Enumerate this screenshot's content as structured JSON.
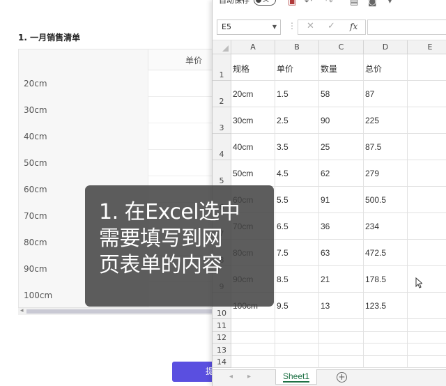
{
  "web_form": {
    "title": "1. 一月销售清单",
    "header_price": "单价",
    "rows": [
      "20cm",
      "30cm",
      "40cm",
      "50cm",
      "60cm",
      "70cm",
      "80cm",
      "90cm",
      "100cm"
    ],
    "submit_label": "提交",
    "accent_color": "#5a4fe0"
  },
  "excel": {
    "toolbar": {
      "autosave_label": "自动保存",
      "autosave_state": "关",
      "icons": [
        "save-icon",
        "undo-icon",
        "redo-icon",
        "print-preview-icon",
        "camera-icon",
        "more-icon"
      ]
    },
    "formula_bar": {
      "name_box": "E5",
      "separator": "⋮",
      "cancel": "✕",
      "enter": "✓",
      "fx": "fx",
      "formula": ""
    },
    "columns": [
      "A",
      "B",
      "C",
      "D",
      "E"
    ],
    "row_numbers": [
      "1",
      "2",
      "3",
      "4",
      "5",
      "6",
      "7",
      "8",
      "9",
      "10",
      "11",
      "12",
      "13",
      "14"
    ],
    "table": [
      [
        "规格",
        "单价",
        "数量",
        "总价"
      ],
      [
        "20cm",
        "1.5",
        "58",
        "87"
      ],
      [
        "30cm",
        "2.5",
        "90",
        "225"
      ],
      [
        "40cm",
        "3.5",
        "25",
        "87.5"
      ],
      [
        "50cm",
        "4.5",
        "62",
        "279"
      ],
      [
        "60cm",
        "5.5",
        "91",
        "500.5"
      ],
      [
        "70cm",
        "6.5",
        "36",
        "234"
      ],
      [
        "80cm",
        "7.5",
        "63",
        "472.5"
      ],
      [
        "90cm",
        "8.5",
        "21",
        "178.5"
      ],
      [
        "100cm",
        "9.5",
        "13",
        "123.5"
      ]
    ],
    "sheet_tab": "Sheet1",
    "add_sheet": "+",
    "brand_color": "#1e7145"
  },
  "overlay": {
    "lines": [
      "1. 在Excel选中",
      "需要填写到网",
      "页表单的内容"
    ]
  }
}
